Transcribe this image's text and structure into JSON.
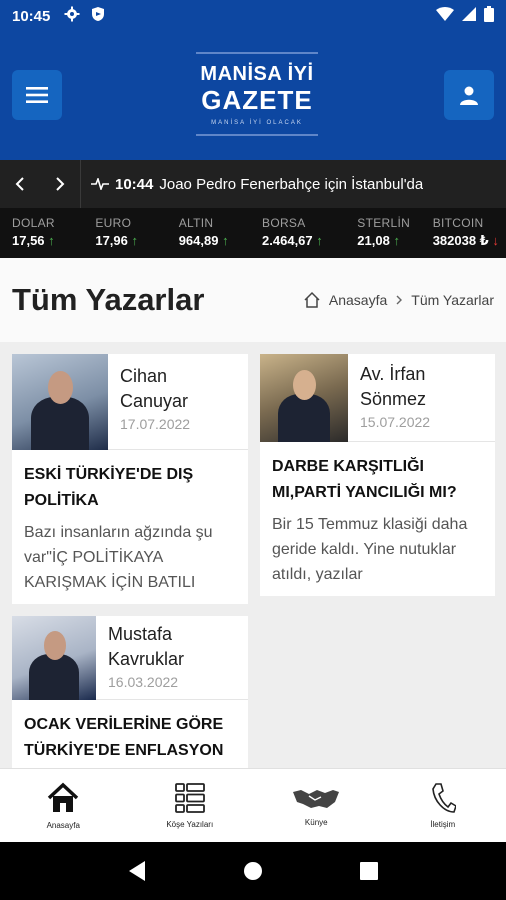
{
  "status": {
    "time": "10:45"
  },
  "logo": {
    "line1": "MANİSA İYİ",
    "line2": "GAZETE",
    "sub": "MANİSA İYİ OLACAK"
  },
  "ticker": {
    "time": "10:44",
    "headline": "Joao Pedro Fenerbahçe için İstanbul'da"
  },
  "market": [
    {
      "name": "DOLAR",
      "value": "17,56",
      "trend": "up"
    },
    {
      "name": "EURO",
      "value": "17,96",
      "trend": "up"
    },
    {
      "name": "ALTIN",
      "value": "964,89",
      "trend": "up"
    },
    {
      "name": "BORSA",
      "value": "2.464,67",
      "trend": "up"
    },
    {
      "name": "STERLİN",
      "value": "21,08",
      "trend": "up"
    },
    {
      "name": "BITCOIN",
      "value": "382038 ₺",
      "trend": "down"
    }
  ],
  "page": {
    "title": "Tüm Yazarlar",
    "breadcrumb_home": "Anasayfa",
    "breadcrumb_current": "Tüm Yazarlar"
  },
  "cards": [
    {
      "author": "Cihan Canuyar",
      "date": "17.07.2022",
      "title": "ESKİ TÜRKİYE'DE DIŞ POLİTİKA",
      "excerpt": "Bazı insanların ağzında şu var\"İÇ POLİTİKAYA KARIŞMAK İÇİN BATILI"
    },
    {
      "author": "Av. İrfan Sönmez",
      "date": "15.07.2022",
      "title": "DARBE KARŞITLIĞI MI,PARTİ YANCILIĞI MI?",
      "excerpt": "Bir 15 Temmuz klasiği daha geride kaldı. Yine nutuklar atıldı, yazılar"
    },
    {
      "author": "Mustafa Kavruklar",
      "date": "16.03.2022",
      "title": "OCAK VERİLERİNE GÖRE TÜRKİYE'DE ENFLASYON",
      "excerpt": ""
    }
  ],
  "nav": [
    {
      "label": "Anasayfa",
      "icon": "home-icon"
    },
    {
      "label": "Köşe Yazıları",
      "icon": "list-icon"
    },
    {
      "label": "Künye",
      "icon": "handshake-icon"
    },
    {
      "label": "İletişim",
      "icon": "phone-icon"
    }
  ],
  "colors": {
    "header": "#0d47a1",
    "ticker_bg": "#212121",
    "market_bg": "#111111",
    "up": "#4caf50",
    "down": "#e53935"
  }
}
